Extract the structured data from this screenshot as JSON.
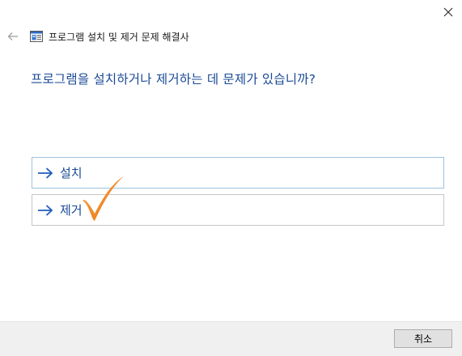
{
  "header": {
    "title": "프로그램 설치 및 제거 문제 해결사",
    "icon": "troubleshooter-app-icon",
    "back_icon": "back-arrow-icon",
    "close_icon": "close-icon"
  },
  "main": {
    "heading": "프로그램을 설치하거나 제거하는 데 문제가 있습니까?",
    "options": [
      {
        "label": "설치",
        "icon": "arrow-right-icon"
      },
      {
        "label": "제거",
        "icon": "arrow-right-icon"
      }
    ]
  },
  "annotation": {
    "icon": "orange-check-mark-icon",
    "color": "#f28a1e"
  },
  "footer": {
    "cancel_label": "취소"
  },
  "colors": {
    "link_blue": "#1a4a96",
    "arrow_blue": "#1e5bbd",
    "selected_border": "#9cc3e2",
    "footer_bg": "#f0f0f0"
  }
}
